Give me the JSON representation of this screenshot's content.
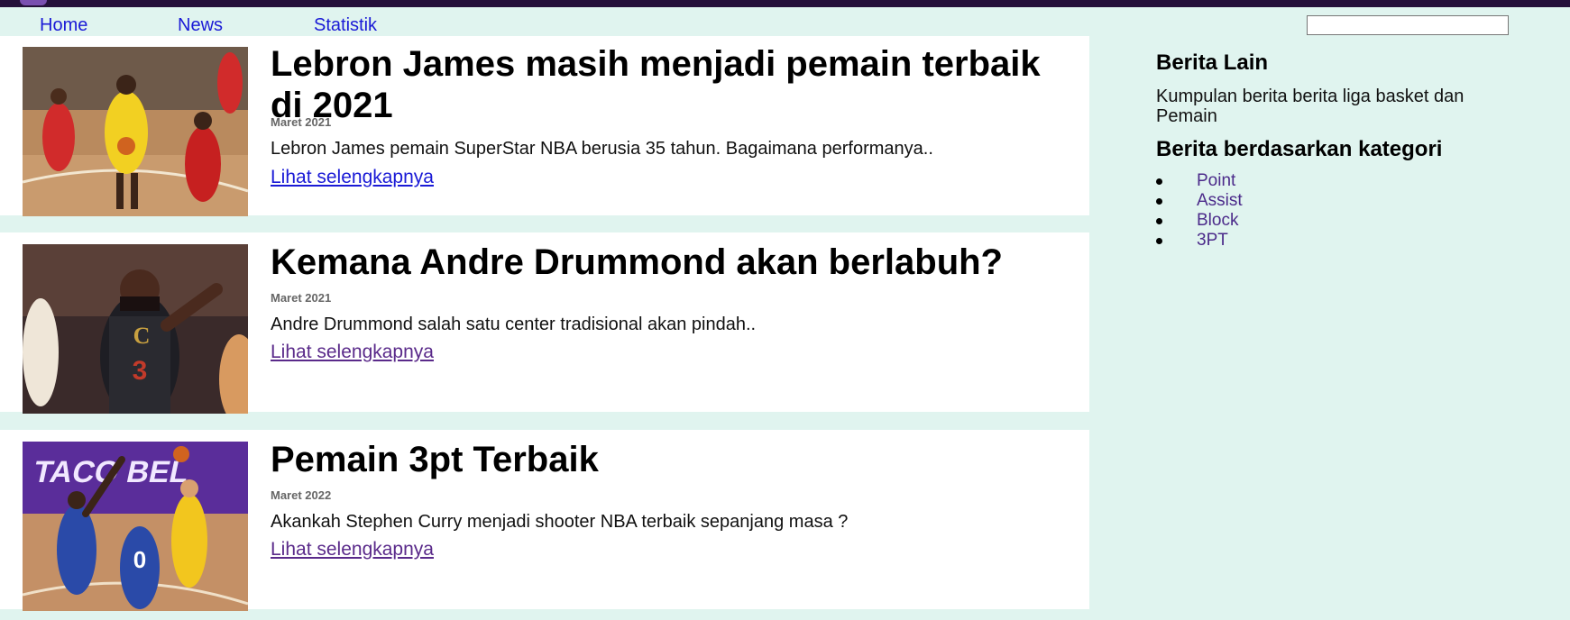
{
  "nav": {
    "items": [
      "Home",
      "News",
      "Statistik"
    ],
    "search_value": ""
  },
  "articles": [
    {
      "title": "Lebron James masih menjadi pemain terbaik di 2021",
      "date": "Maret 2021",
      "excerpt": "Lebron James pemain SuperStar NBA berusia 35 tahun. Bagaimana performanya..",
      "link_label": "Lihat selengkapnya",
      "image_icon": "lakers-player-photo"
    },
    {
      "title": "Kemana Andre Drummond akan berlabuh?",
      "date": "Maret 2021",
      "excerpt": "Andre Drummond salah satu center tradisional akan pindah..",
      "link_label": "Lihat selengkapnya",
      "image_icon": "cavaliers-player-photo"
    },
    {
      "title": "Pemain 3pt Terbaik",
      "date": "Maret 2022",
      "excerpt": "Akankah Stephen Curry menjadi shooter NBA terbaik sepanjang masa ?",
      "link_label": "Lihat selengkapnya",
      "image_icon": "allstar-shooter-photo"
    }
  ],
  "sidebar": {
    "heading1": "Berita Lain",
    "text": "Kumpulan berita berita liga basket dan Pemain",
    "heading2": "Berita berdasarkan kategori",
    "categories": [
      "Point",
      "Assist",
      "Block",
      "3PT"
    ]
  },
  "colors": {
    "background": "#e0f4ef",
    "topbar": "#25103a",
    "link": "#1a1ad6",
    "visited_link": "#5a2a8a"
  }
}
